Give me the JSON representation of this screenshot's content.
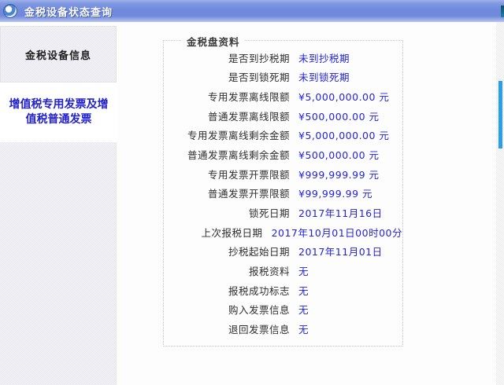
{
  "title_bar": {
    "title": "金税设备状态查询"
  },
  "sidebar": {
    "items": [
      {
        "label": "金税设备信息",
        "selected": false
      },
      {
        "label": "增值税专用发票及增值税普通发票",
        "selected": true
      }
    ]
  },
  "main": {
    "fieldset_title": "金税盘资料",
    "rows": [
      {
        "label": "是否到抄税期",
        "value": "未到抄税期"
      },
      {
        "label": "是否到锁死期",
        "value": "未到锁死期"
      },
      {
        "label": "专用发票离线限额",
        "value": "¥5,000,000.00 元"
      },
      {
        "label": "普通发票离线限额",
        "value": "¥500,000.00 元"
      },
      {
        "label": "专用发票离线剩余金额",
        "value": "¥5,000,000.00 元"
      },
      {
        "label": "普通发票离线剩余金额",
        "value": "¥500,000.00 元"
      },
      {
        "label": "专用发票开票限额",
        "value": "¥999,999.99 元"
      },
      {
        "label": "普通发票开票限额",
        "value": "¥99,999.99 元"
      },
      {
        "label": "锁死日期",
        "value": "2017年11月16日"
      },
      {
        "label": "上次报税日期",
        "value": "2017年10月01日00时00分"
      },
      {
        "label": "抄税起始日期",
        "value": "2017年11月01日"
      },
      {
        "label": "报税资料",
        "value": "无"
      },
      {
        "label": "报税成功标志",
        "value": "无"
      },
      {
        "label": "购入发票信息",
        "value": "无"
      },
      {
        "label": "退回发票信息",
        "value": "无"
      }
    ]
  },
  "icons": {
    "app_icon": "app-logo-circle",
    "titlebar_notch": "window-edge-mark"
  },
  "colors": {
    "titlebar_blue": "#7089dc",
    "value_text_blue": "#2222e2",
    "sidebar_active_blue": "#2222cc",
    "scrollbar_thumb_blue": "#2b9fe6"
  }
}
